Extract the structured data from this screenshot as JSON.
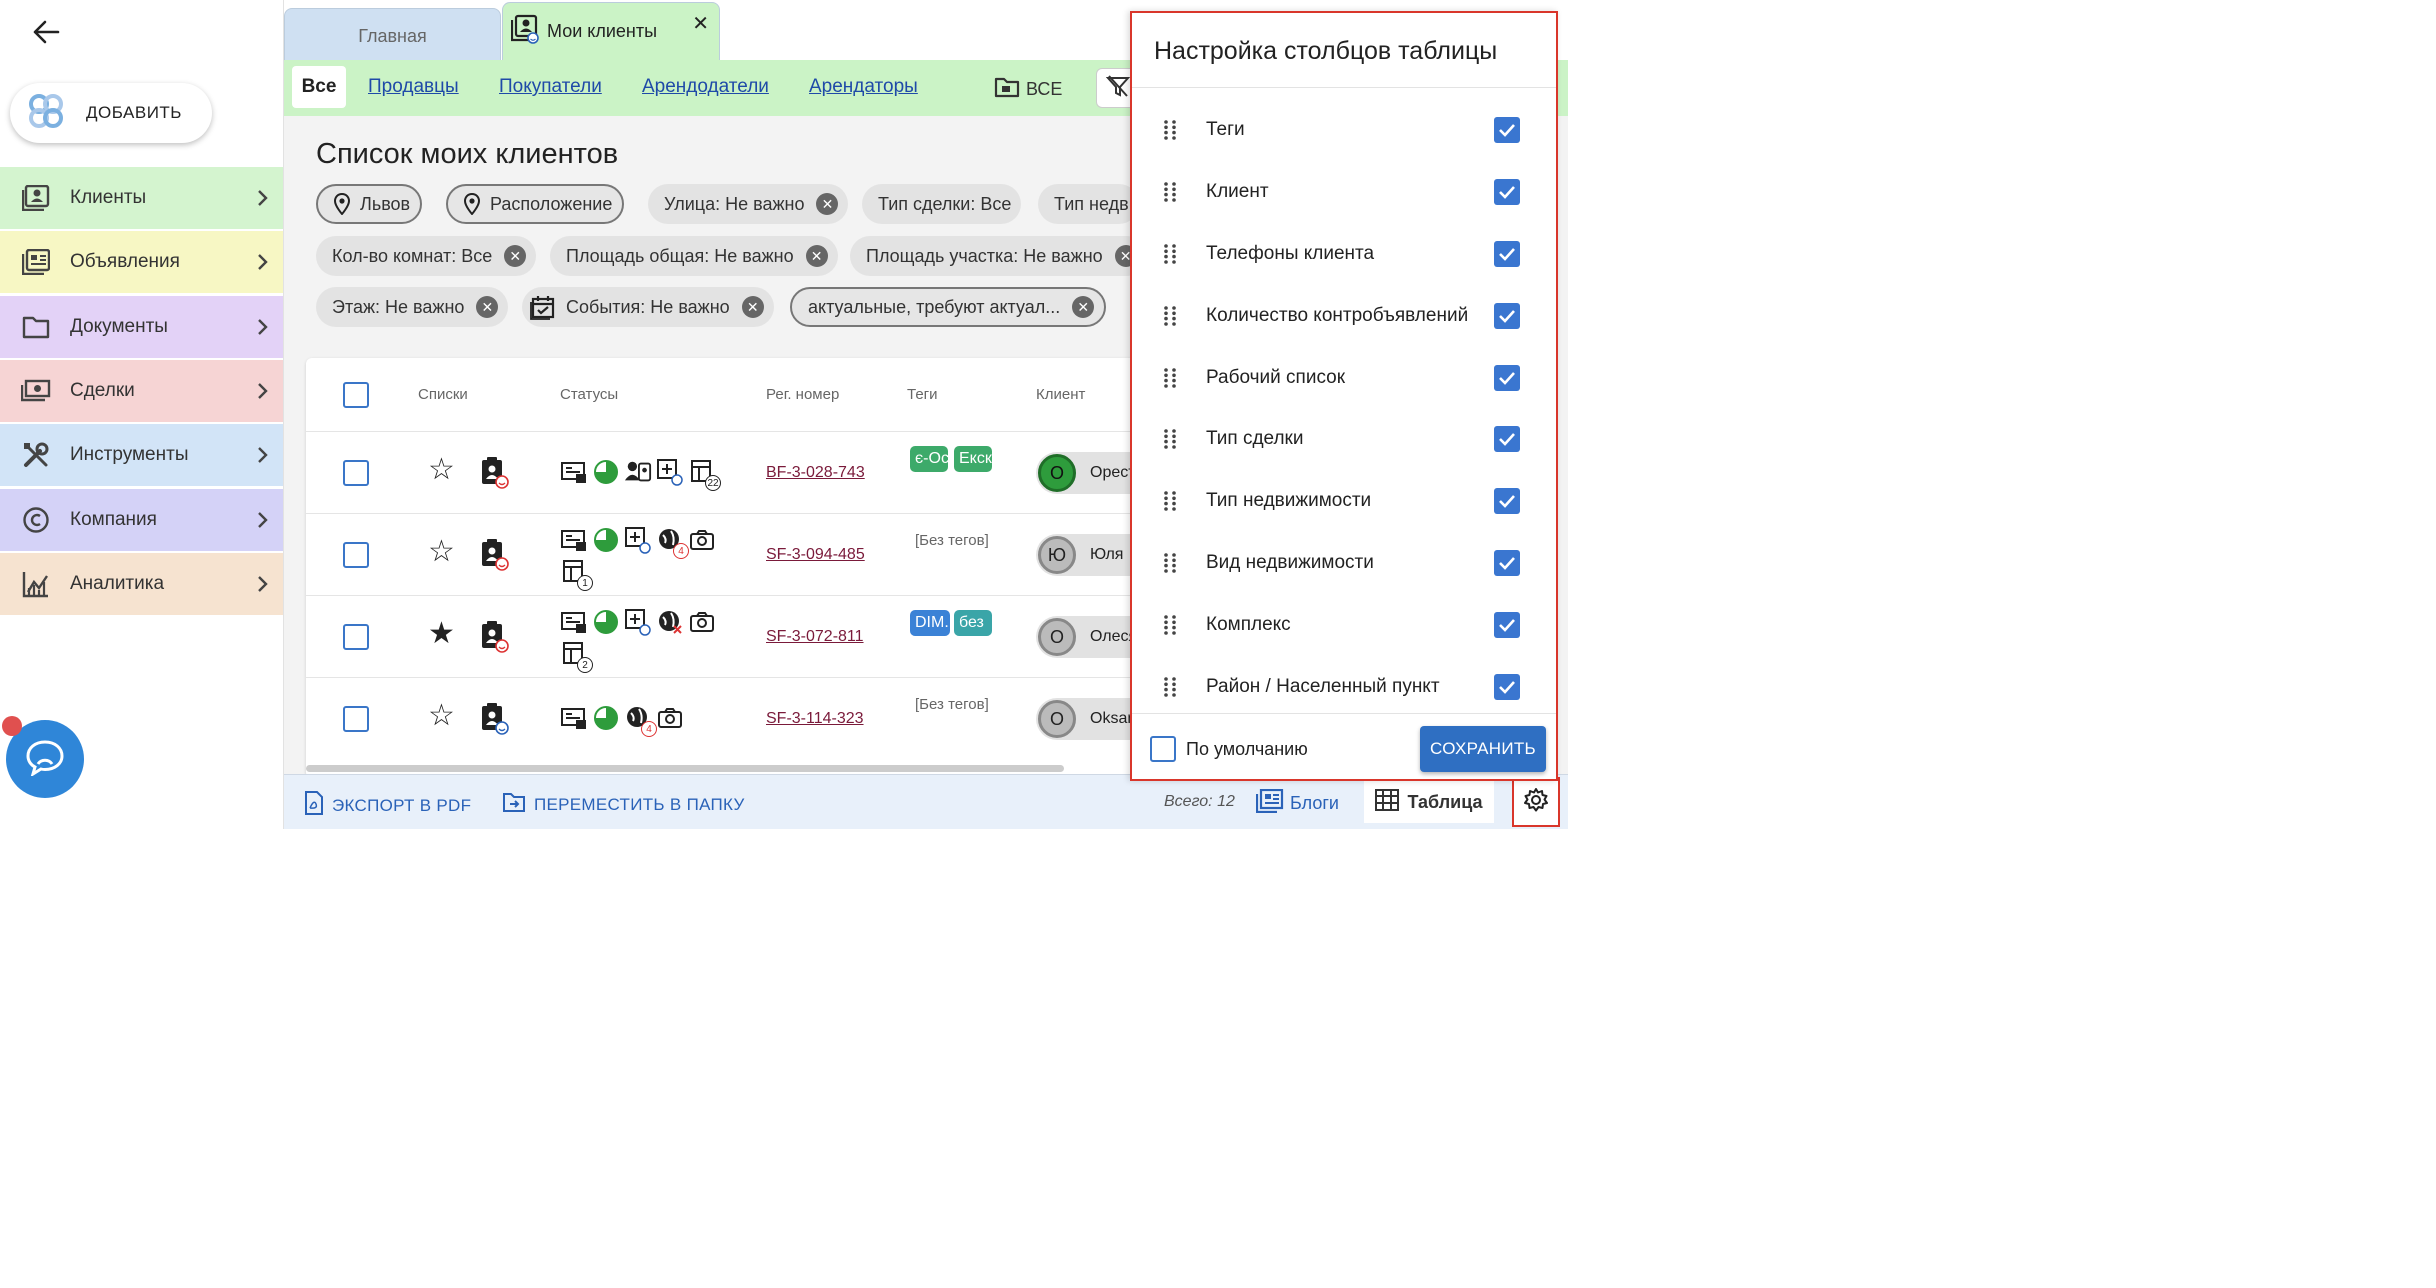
{
  "sidebar": {
    "add_label": "ДОБАВИТЬ",
    "items": [
      {
        "label": "Клиенты",
        "color": "#d4f4cf"
      },
      {
        "label": "Объявления",
        "color": "#f7f7c4"
      },
      {
        "label": "Документы",
        "color": "#e3d2f7"
      },
      {
        "label": "Сделки",
        "color": "#f6d4d4"
      },
      {
        "label": "Инструменты",
        "color": "#d2e4f7"
      },
      {
        "label": "Компания",
        "color": "#d4d2f7"
      },
      {
        "label": "Аналитика",
        "color": "#f6e3d0"
      }
    ]
  },
  "tabs": {
    "home": "Главная",
    "clients": "Мои клиенты"
  },
  "subtabs": {
    "all": "Все",
    "links": [
      "Продавцы",
      "Покупатели",
      "Арендодатели",
      "Арендаторы"
    ],
    "folder": "ВСЕ"
  },
  "main": {
    "title": "Список моих клиентов",
    "chips_row1": [
      "Львов",
      "Расположение",
      "Улица: Не важно",
      "Тип сделки: Все",
      "Тип недв"
    ],
    "chips_row2": [
      "Кол-во комнат: Все",
      "Площадь общая: Не важно",
      "Площадь участка: Не важно"
    ],
    "chips_row3": [
      "Этаж: Не важно",
      "События: Не важно",
      "актуальные, требуют актуал..."
    ]
  },
  "table": {
    "headers": [
      "Списки",
      "Статусы",
      "Рег. номер",
      "Теги",
      "Клиент"
    ],
    "rows": [
      {
        "starred": false,
        "reg": "BF-3-028-743",
        "tags": [
          "є-Ос",
          "Екск"
        ],
        "no_tags": "",
        "avatar": "О",
        "name": "Орест",
        "badges": [
          "22"
        ]
      },
      {
        "starred": false,
        "reg": "SF-3-094-485",
        "tags": [],
        "no_tags": "[Без тегов]",
        "avatar": "Ю",
        "name": "Юля",
        "badges": [
          "4",
          "1"
        ]
      },
      {
        "starred": true,
        "reg": "SF-3-072-811",
        "tags": [
          "DIM.",
          "без"
        ],
        "no_tags": "",
        "avatar": "О",
        "name": "Олеся",
        "badges": [
          "2"
        ]
      },
      {
        "starred": false,
        "reg": "SF-3-114-323",
        "tags": [],
        "no_tags": "[Без тегов]",
        "avatar": "О",
        "name": "Oksana",
        "badges": [
          "4"
        ]
      }
    ]
  },
  "bottom": {
    "export": "ЭКСПОРТ В PDF",
    "move": "ПЕРЕМЕСТИТЬ В ПАПКУ",
    "total": "Всего: 12",
    "blogs": "Блоги",
    "table": "Таблица"
  },
  "panel": {
    "title": "Настройка столбцов таблицы",
    "columns": [
      "Теги",
      "Клиент",
      "Телефоны клиента",
      "Количество контробъявлений",
      "Рабочий список",
      "Тип сделки",
      "Тип недвижимости",
      "Вид недвижимости",
      "Комплекс",
      "Район / Населенный пункт"
    ],
    "default_label": "По умолчанию",
    "save_label": "СОХРАНИТЬ"
  },
  "colors": {
    "accent": "#2f6fc2",
    "highlight": "#d9362b",
    "tag_green": "#3daa6a",
    "tag_blue": "#3b82d6",
    "tag_teal": "#3aa5a8"
  }
}
